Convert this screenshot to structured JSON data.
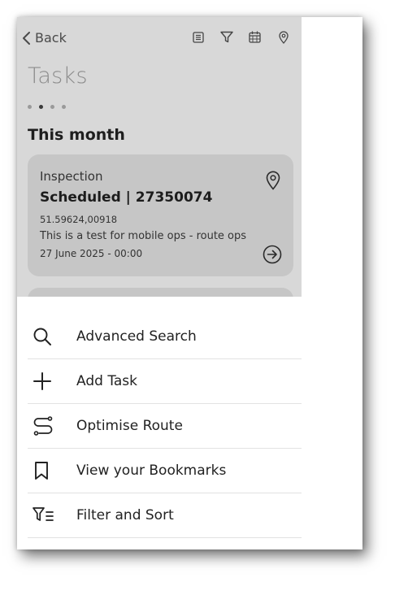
{
  "header": {
    "back_label": "Back",
    "icons": [
      "list-icon",
      "filter-icon",
      "calendar-icon",
      "location-pin-icon"
    ]
  },
  "page": {
    "title": "Tasks",
    "pager_dots": 4,
    "active_dot": 2
  },
  "section": {
    "title": "This month"
  },
  "task": {
    "type": "Inspection",
    "status_ref": "Scheduled | 27350074",
    "coords": "51.59624,00918",
    "description": "This is a test for mobile ops - route ops",
    "datetime": "27 June 2025 - 00:00"
  },
  "menu": {
    "items": [
      {
        "label": "Advanced Search",
        "icon": "search-icon"
      },
      {
        "label": "Add Task",
        "icon": "plus-icon"
      },
      {
        "label": "Optimise Route",
        "icon": "route-icon"
      },
      {
        "label": "View your Bookmarks",
        "icon": "bookmark-icon"
      },
      {
        "label": "Filter and Sort",
        "icon": "filter-sort-icon"
      }
    ]
  },
  "colors": {
    "overlay_bg": "#d8d8d8",
    "card_bg": "#c6c6c6",
    "sheet_bg": "#ffffff",
    "text_dark": "#1e1e1e",
    "title_grey": "#8c8c8c"
  }
}
